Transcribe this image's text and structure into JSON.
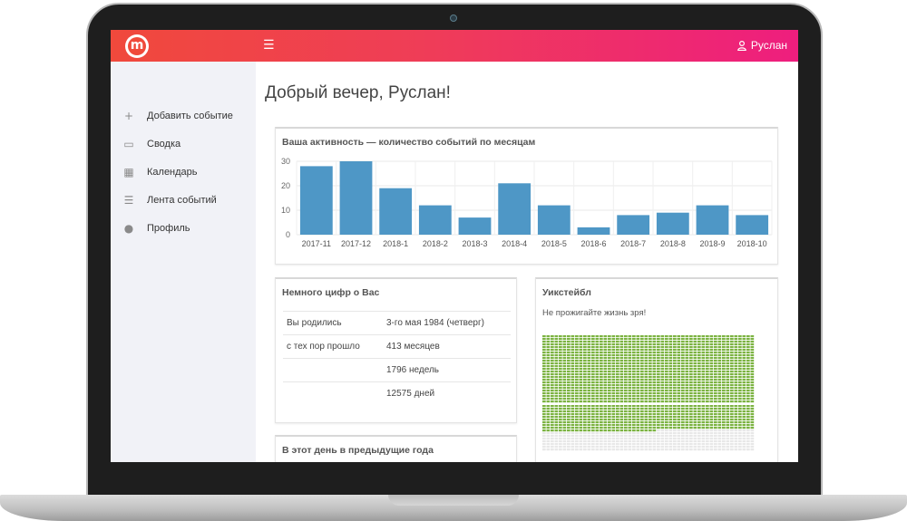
{
  "app": {
    "logo_letter": "m",
    "menu_icon": "☰",
    "user_name": "Руслан",
    "brand_colors": {
      "start": "#f0493c",
      "end": "#ee1e7e"
    }
  },
  "sidebar": {
    "items": [
      {
        "icon": "plus-icon",
        "glyph": "+",
        "label": "Добавить событие"
      },
      {
        "icon": "id-card-icon",
        "glyph": "▭",
        "label": "Сводка"
      },
      {
        "icon": "calendar-icon",
        "glyph": "▦",
        "label": "Календарь"
      },
      {
        "icon": "list-icon",
        "glyph": "☰",
        "label": "Лента событий"
      },
      {
        "icon": "user-icon",
        "glyph": "●",
        "label": "Профиль"
      }
    ]
  },
  "main": {
    "greeting": "Добрый вечер, Руслан!"
  },
  "activity": {
    "title": "Ваша активность — количество событий по месяцам"
  },
  "chart_data": {
    "type": "bar",
    "title": "Ваша активность — количество событий по месяцам",
    "categories": [
      "2017-11",
      "2017-12",
      "2018-1",
      "2018-2",
      "2018-3",
      "2018-4",
      "2018-5",
      "2018-6",
      "2018-7",
      "2018-8",
      "2018-9",
      "2018-10"
    ],
    "values": [
      28,
      30,
      19,
      12,
      7,
      21,
      12,
      3,
      8,
      9,
      12,
      8
    ],
    "ylim": [
      0,
      30
    ],
    "yticks": [
      0,
      10,
      20,
      30
    ],
    "grid": true,
    "bar_color": "#4e97c6"
  },
  "stats": {
    "title": "Немного цифр о Вас",
    "rows": [
      {
        "label": "Вы родились",
        "value": "3-го мая 1984 (четверг)"
      },
      {
        "label": "с тех пор прошло",
        "value": "413 месяцев"
      },
      {
        "label": "",
        "value": "1796 недель"
      },
      {
        "label": "",
        "value": "12575 дней"
      }
    ]
  },
  "onthisday": {
    "title": "В этот день в предыдущие года"
  },
  "weeks": {
    "title": "Уикстейбл",
    "subtitle": "Не прожигайте жизнь зря!",
    "lived_weeks": 1796,
    "lived_color": "#7cb342",
    "empty_color": "#e8e8e8"
  }
}
